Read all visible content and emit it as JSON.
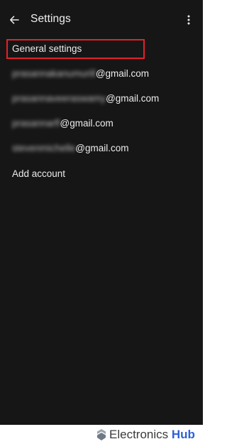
{
  "appbar": {
    "title": "Settings",
    "back_icon": "arrow-left-icon",
    "more_icon": "more-vert-icon"
  },
  "general_settings": {
    "label": "General settings",
    "highlight_color": "#e4202a"
  },
  "accounts": [
    {
      "name_blurred": "prasannakanumurill",
      "domain": "@gmail.com"
    },
    {
      "name_blurred": "prasannaveeraswamy",
      "domain": "@gmail.com"
    },
    {
      "name_blurred": "prasannarfl",
      "domain": "@gmail.com"
    },
    {
      "name_blurred": "stevenmichelle",
      "domain": "@gmail.com"
    }
  ],
  "add_account": {
    "label": "Add account"
  },
  "watermark": {
    "brand_primary": "Electronics",
    "brand_secondary": "Hub",
    "icon": "electronics-hub-logo-icon"
  },
  "colors": {
    "background": "#161616",
    "text": "#ececec",
    "watermark_blue": "#2d62d6"
  }
}
